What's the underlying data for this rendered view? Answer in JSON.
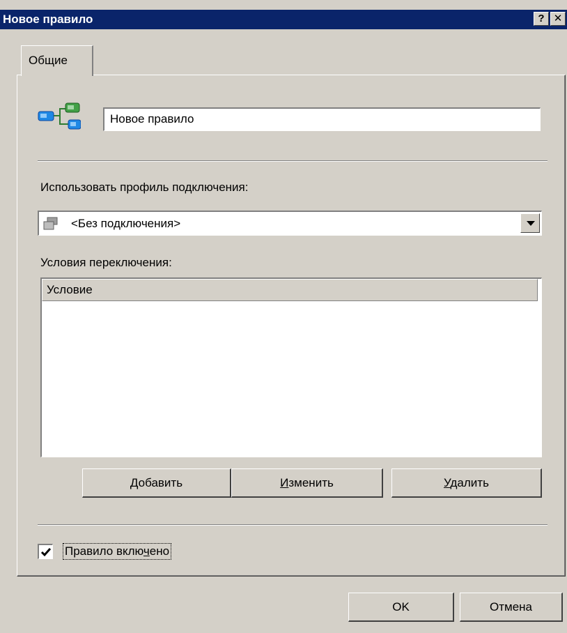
{
  "window": {
    "title": "Новое правило",
    "help_button": "?",
    "close_button": "✕"
  },
  "tabs": [
    {
      "label": "Общие",
      "active": true
    }
  ],
  "rule": {
    "name_value": "Новое правило",
    "icon": "rule-tree-icon"
  },
  "profile": {
    "label": "Использовать профиль подключения:",
    "selected": "<Без подключения>",
    "icon": "connection-icon"
  },
  "conditions": {
    "label": "Условия переключения:",
    "column_header": "Условие",
    "rows": []
  },
  "buttons": {
    "add": {
      "underline": "Д",
      "rest": "обавить"
    },
    "edit": {
      "underline": "И",
      "rest": "зменить"
    },
    "delete": {
      "underline": "У",
      "rest": "далить"
    },
    "ok": "OK",
    "cancel": "Отмена"
  },
  "enabled": {
    "pre": "Правило вклю",
    "underline": "ч",
    "post": "ено",
    "checked": true
  }
}
